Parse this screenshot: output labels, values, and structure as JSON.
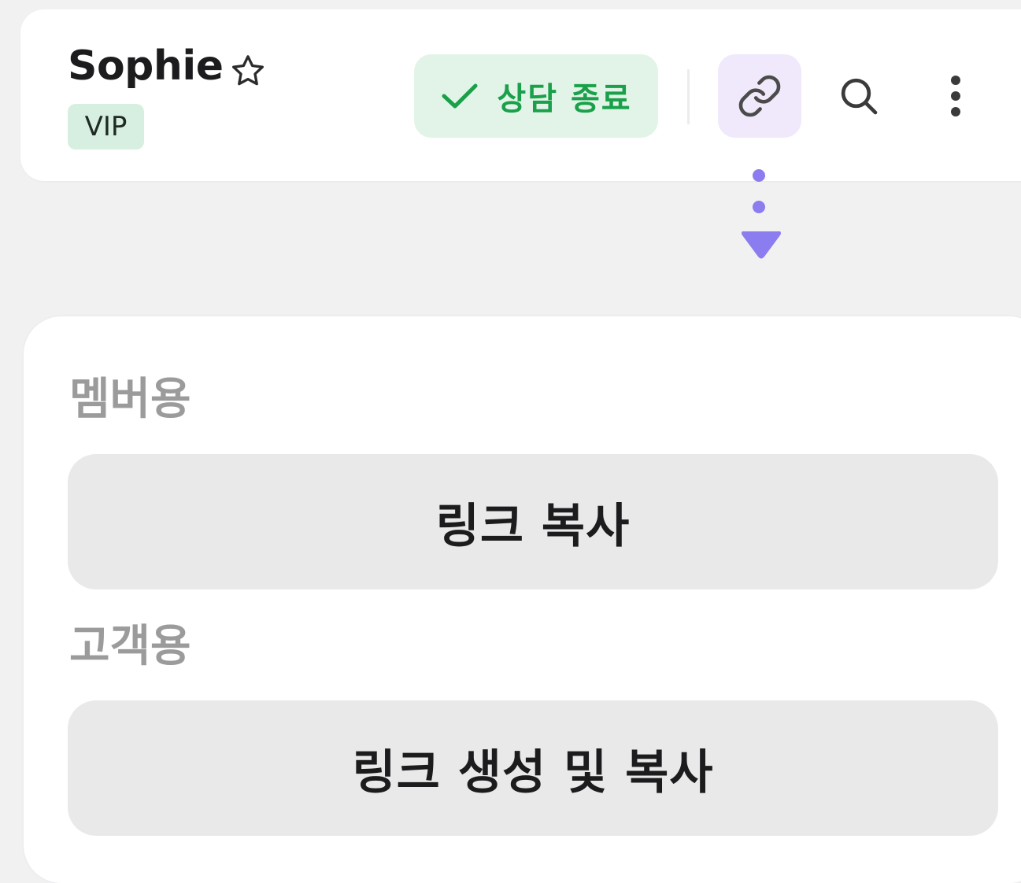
{
  "header": {
    "name": "Sophie",
    "badge": "VIP",
    "end_consultation_label": "상담 종료",
    "icons": {
      "favorite": "star-outline-icon",
      "end": "check-icon",
      "link": "link-icon",
      "search": "search-icon",
      "more": "more-vertical-icon",
      "pointer": "arrow-down-pointer-icon"
    }
  },
  "popup": {
    "member_section_label": "멤버용",
    "member_button_label": "링크 복사",
    "customer_section_label": "고객용",
    "customer_button_label": "링크 생성 및 복사"
  },
  "colors": {
    "accent_green": "#1aa04a",
    "green_bg": "#e2f4e7",
    "vip_bg": "#d7efe0",
    "link_purple": "#8b7cf0",
    "link_bg": "#efe9fb",
    "page_bg": "#f1f1f2"
  }
}
